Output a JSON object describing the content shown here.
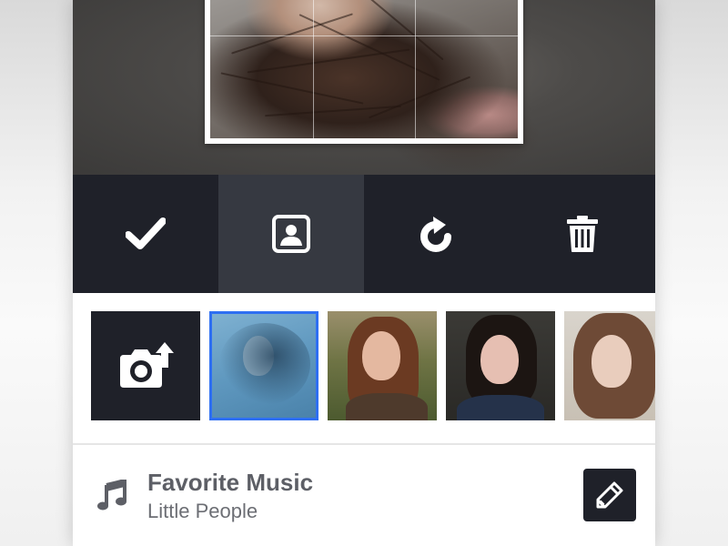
{
  "editor": {
    "toolbar": {
      "items": [
        {
          "name": "confirm",
          "icon": "checkmark-icon",
          "active": false
        },
        {
          "name": "portrait",
          "icon": "portrait-frame-icon",
          "active": true
        },
        {
          "name": "rotate",
          "icon": "rotate-icon",
          "active": false
        },
        {
          "name": "delete",
          "icon": "trash-icon",
          "active": false
        }
      ]
    },
    "thumbnails": {
      "upload_icon": "camera-upload-icon",
      "selected_border_color": "#2e6ff2",
      "photos_count_visible": 4
    }
  },
  "music": {
    "icon": "music-note-icon",
    "title": "Favorite Music",
    "artist": "Little People",
    "edit_icon": "pencil-icon"
  },
  "colors": {
    "toolbar_bg": "#1f2129",
    "toolbar_active_bg": "#363941",
    "accent": "#2e6ff2",
    "text_primary": "#5d5f66",
    "text_secondary": "#6c6e74"
  }
}
